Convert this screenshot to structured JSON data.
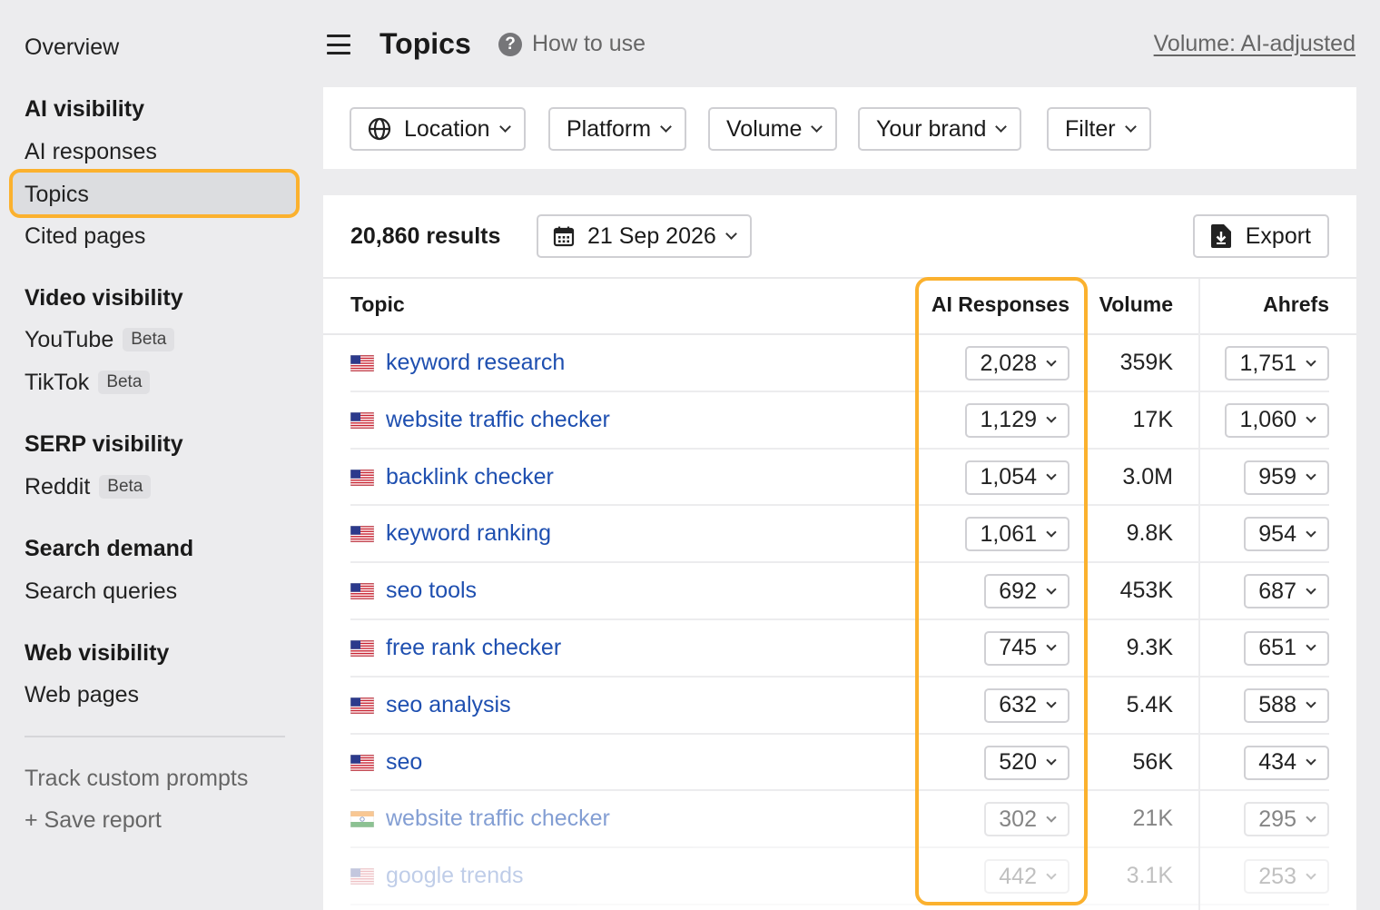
{
  "sidebar": {
    "overview": "Overview",
    "ai_visibility": {
      "heading": "AI visibility",
      "items": [
        "AI responses",
        "Topics",
        "Cited pages"
      ]
    },
    "video_visibility": {
      "heading": "Video visibility",
      "youtube": "YouTube",
      "tiktok": "TikTok",
      "badge": "Beta"
    },
    "serp_visibility": {
      "heading": "SERP visibility",
      "reddit": "Reddit",
      "badge": "Beta"
    },
    "search_demand": {
      "heading": "Search demand",
      "items": [
        "Search queries"
      ]
    },
    "web_visibility": {
      "heading": "Web visibility",
      "items": [
        "Web pages"
      ]
    },
    "track_custom": "Track custom prompts",
    "save_report": "+ Save report",
    "active_item": "Topics"
  },
  "header": {
    "title": "Topics",
    "help_icon": "question-circle-icon",
    "how_to": "How to use",
    "volume_mode": "Volume: AI-adjusted"
  },
  "filters": {
    "location": "Location",
    "platform": "Platform",
    "volume": "Volume",
    "your_brand": "Your brand",
    "filter": "Filter"
  },
  "results": {
    "count": "20,860 results",
    "date": "21 Sep 2026",
    "export": "Export"
  },
  "table": {
    "headers": {
      "topic": "Topic",
      "ai_responses": "AI Responses",
      "volume": "Volume",
      "ahrefs": "Ahrefs"
    },
    "rows": [
      {
        "flag": "us",
        "topic": "keyword research",
        "ai": "2,028",
        "volume": "359K",
        "ahrefs": "1,751"
      },
      {
        "flag": "us",
        "topic": "website traffic checker",
        "ai": "1,129",
        "volume": "17K",
        "ahrefs": "1,060"
      },
      {
        "flag": "us",
        "topic": "backlink checker",
        "ai": "1,054",
        "volume": "3.0M",
        "ahrefs": "959"
      },
      {
        "flag": "us",
        "topic": "keyword ranking",
        "ai": "1,061",
        "volume": "9.8K",
        "ahrefs": "954"
      },
      {
        "flag": "us",
        "topic": "seo tools",
        "ai": "692",
        "volume": "453K",
        "ahrefs": "687"
      },
      {
        "flag": "us",
        "topic": "free rank checker",
        "ai": "745",
        "volume": "9.3K",
        "ahrefs": "651"
      },
      {
        "flag": "us",
        "topic": "seo analysis",
        "ai": "632",
        "volume": "5.4K",
        "ahrefs": "588"
      },
      {
        "flag": "us",
        "topic": "seo",
        "ai": "520",
        "volume": "56K",
        "ahrefs": "434"
      },
      {
        "flag": "in",
        "topic": "website traffic checker",
        "ai": "302",
        "volume": "21K",
        "ahrefs": "295"
      },
      {
        "flag": "us",
        "topic": "google trends",
        "ai": "442",
        "volume": "3.1K",
        "ahrefs": "253"
      }
    ]
  },
  "colors": {
    "highlight": "#fbb12e",
    "link": "#1e4fb0",
    "background": "#ececee"
  }
}
